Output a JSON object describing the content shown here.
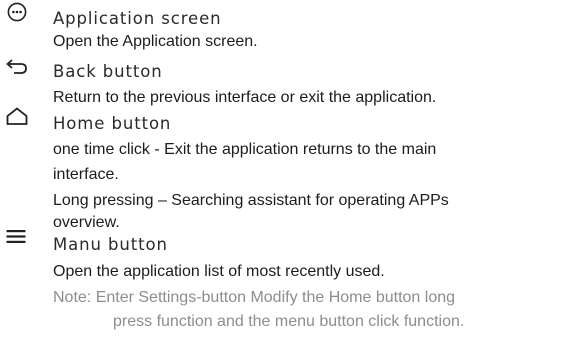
{
  "items": [
    {
      "icon": "apps-grid-icon",
      "title": "Application screen",
      "lines": [
        "Open the Application screen."
      ]
    },
    {
      "icon": "back-arrow-icon",
      "title": "Back button",
      "lines": [
        "Return to the previous interface or exit the application."
      ]
    },
    {
      "icon": "home-icon",
      "title": "Home button",
      "lines": [
        "one time click - Exit the application returns to the main",
        "interface.",
        "Long pressing – Searching assistant for operating APPs",
        "overview."
      ]
    },
    {
      "icon": "menu-icon",
      "title": "Manu button",
      "lines": [
        "Open the application list of most recently used."
      ]
    }
  ],
  "note": {
    "line1": "Note: Enter Settings-button Modify the Home button long",
    "line2": "press function and the menu button click function."
  }
}
